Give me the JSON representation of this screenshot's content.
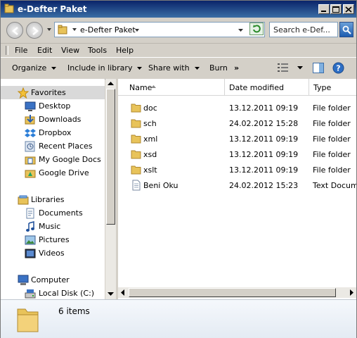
{
  "window": {
    "title": "e-Defter Paket"
  },
  "address": {
    "breadcrumb": "e-Defter Paket",
    "search_placeholder": "Search e-Def..."
  },
  "menu": [
    "File",
    "Edit",
    "View",
    "Tools",
    "Help"
  ],
  "commands": {
    "organize": "Organize",
    "include": "Include in library",
    "share": "Share with",
    "burn": "Burn",
    "more": "»"
  },
  "nav": {
    "favorites": {
      "label": "Favorites",
      "items": [
        "Desktop",
        "Downloads",
        "Dropbox",
        "Recent Places",
        "My Google Docs",
        "Google Drive"
      ]
    },
    "libraries": {
      "label": "Libraries",
      "items": [
        "Documents",
        "Music",
        "Pictures",
        "Videos"
      ]
    },
    "computer": {
      "label": "Computer",
      "items": [
        "Local Disk (C:)"
      ]
    }
  },
  "columns": {
    "name": "Name",
    "date": "Date modified",
    "type": "Type"
  },
  "files": [
    {
      "name": "doc",
      "date": "13.12.2011 09:19",
      "type": "File folder",
      "icon": "folder-icon"
    },
    {
      "name": "sch",
      "date": "24.02.2012 15:28",
      "type": "File folder",
      "icon": "folder-icon"
    },
    {
      "name": "xml",
      "date": "13.12.2011 09:19",
      "type": "File folder",
      "icon": "folder-icon"
    },
    {
      "name": "xsd",
      "date": "13.12.2011 09:19",
      "type": "File folder",
      "icon": "folder-icon"
    },
    {
      "name": "xslt",
      "date": "13.12.2011 09:19",
      "type": "File folder",
      "icon": "folder-icon"
    },
    {
      "name": "Beni Oku",
      "date": "24.02.2012 15:23",
      "type": "Text Document",
      "icon": "text-document-icon"
    }
  ],
  "details": {
    "item_count": "6 items"
  },
  "colors": {
    "title_bar": "#0a246a",
    "folder": "#e8c35a",
    "selection": "#d9d9d9"
  }
}
